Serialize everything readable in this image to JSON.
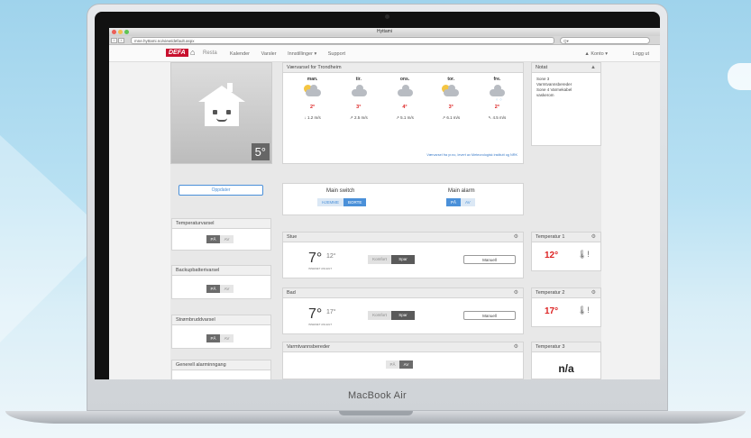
{
  "browser": {
    "window_title": "Hyttami",
    "url": "mne.hyttami.no/view/default.aspx",
    "search_placeholder": "Q▾"
  },
  "site": {
    "logo": "DEFA",
    "product": "Resta",
    "menu": [
      "Kalender",
      "Varsler",
      "Innstillinger ▾",
      "Support"
    ],
    "account": "Konto ▾",
    "logout": "Logg ut"
  },
  "house": {
    "temperature": "5°"
  },
  "forecast": {
    "title": "Værvarsel for Trondheim",
    "days": [
      {
        "name": "man.",
        "icon": "sun-cloud",
        "temp": "2°",
        "wind": "1.2 m/s",
        "arrow": "↓"
      },
      {
        "name": "tir.",
        "icon": "cloud",
        "temp": "3°",
        "wind": "2.5 m/s",
        "arrow": "↗"
      },
      {
        "name": "ons.",
        "icon": "cloud",
        "temp": "4°",
        "wind": "5.1 m/s",
        "arrow": "↗"
      },
      {
        "name": "tor.",
        "icon": "sun-cloud",
        "temp": "3°",
        "wind": "6.1 m/s",
        "arrow": "↗"
      },
      {
        "name": "fre.",
        "icon": "rain-cloud",
        "temp": "2°",
        "wind": "4.5 m/s",
        "arrow": "↖"
      }
    ],
    "note": "Værvarsel fra yr.no, levert av Meteorologisk institutt og NRK"
  },
  "notat": {
    "title": "Notat",
    "lines": [
      "Sone 3",
      "Varmtvannsbereder",
      "Sone 4 Varmekabel",
      "vaskerom"
    ]
  },
  "update_button": "Oppdater",
  "side_panels": [
    {
      "title": "Temperaturvarsel",
      "on": "PÅ",
      "off": "AV"
    },
    {
      "title": "Backupbatterivarsel",
      "on": "PÅ",
      "off": "AV"
    },
    {
      "title": "Strømbruddvarsel",
      "on": "PÅ",
      "off": "AV"
    },
    {
      "title": "Generell alarminngang"
    }
  ],
  "switches": {
    "main_switch": {
      "label": "Main switch",
      "opt1": "HJEMME",
      "opt2": "BORTE"
    },
    "main_alarm": {
      "label": "Main alarm",
      "opt1": "PÅ",
      "opt2": "AV"
    }
  },
  "rooms": [
    {
      "title": "Stue",
      "temp": "7°",
      "set": "12°",
      "label_actual": "INNEMET",
      "label_set": "ANLEGT",
      "modes": [
        "Komfort",
        "Spar"
      ],
      "manual": "Manuell"
    },
    {
      "title": "Bad",
      "temp": "7°",
      "set": "17°",
      "label_actual": "INNEMET",
      "label_set": "ANLEGT",
      "modes": [
        "Komfort",
        "Spar"
      ],
      "manual": "Manuell"
    }
  ],
  "water_heater": {
    "title": "Varmtvannsbereder",
    "on": "PÅ",
    "off": "AV"
  },
  "temp_panels": [
    {
      "title": "Temperatur 1",
      "value": "12°"
    },
    {
      "title": "Temperatur 2",
      "value": "17°"
    },
    {
      "title": "Temperatur 3",
      "value": "n/a"
    }
  ],
  "laptop_brand": "MacBook Air"
}
